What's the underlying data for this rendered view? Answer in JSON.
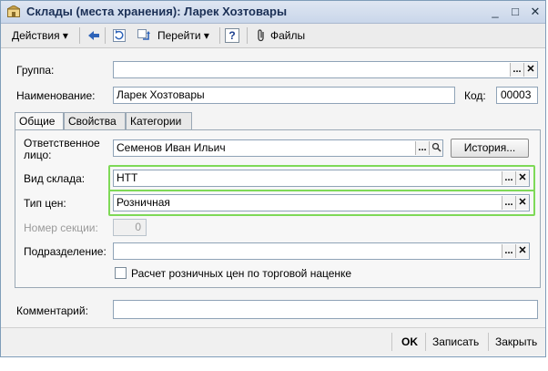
{
  "window": {
    "title": "Склады (места хранения): Ларек Хозтовары",
    "minimize": "_",
    "maximize": "□",
    "close": "✕"
  },
  "toolbar": {
    "actions_label": "Действия",
    "goto_label": "Перейти",
    "help_label": "?",
    "files_label": "Файлы"
  },
  "form": {
    "group_label": "Группа:",
    "group_value": "",
    "name_label": "Наименование:",
    "name_value": "Ларек Хозтовары",
    "code_label": "Код:",
    "code_value": "00003"
  },
  "tabs": [
    {
      "label": "Общие",
      "active": true
    },
    {
      "label": "Свойства",
      "active": false
    },
    {
      "label": "Категории",
      "active": false
    }
  ],
  "general": {
    "responsible_label_line1": "Ответственное",
    "responsible_label_line2": "лицо:",
    "responsible_value": "Семенов Иван Ильич",
    "history_button": "История...",
    "warehouse_type_label": "Вид склада:",
    "warehouse_type_value": "НТТ",
    "price_type_label": "Тип цен:",
    "price_type_value": "Розничная",
    "section_label": "Номер секции:",
    "section_value": "0",
    "department_label": "Подразделение:",
    "department_value": "",
    "markup_checkbox_label": "Расчет розничных цен по торговой наценке",
    "markup_checked": false
  },
  "comment": {
    "label": "Комментарий:",
    "value": ""
  },
  "buttons": {
    "ok": "OK",
    "save": "Записать",
    "close": "Закрыть"
  },
  "glyphs": {
    "dots": "...",
    "clear": "✕",
    "dropdown": "▾"
  },
  "colors": {
    "highlight": "#7ed957",
    "title_text": "#1a2f55"
  }
}
